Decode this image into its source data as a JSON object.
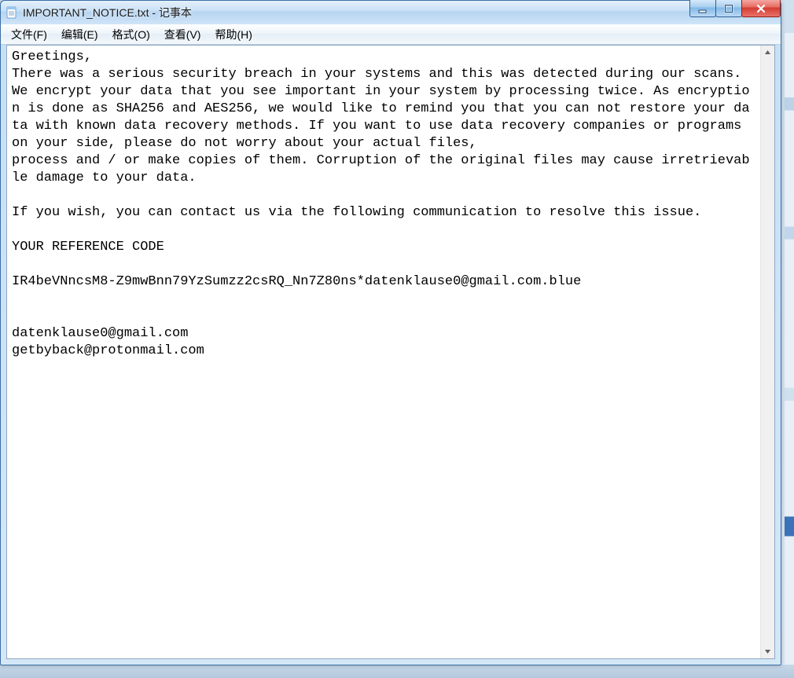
{
  "window": {
    "title": "IMPORTANT_NOTICE.txt - 记事本"
  },
  "menu": {
    "file": "文件(F)",
    "edit": "编辑(E)",
    "format": "格式(O)",
    "view": "查看(V)",
    "help": "帮助(H)"
  },
  "content": "Greetings,\nThere was a serious security breach in your systems and this was detected during our scans.\nWe encrypt your data that you see important in your system by processing twice. As encryption is done as SHA256 and AES256, we would like to remind you that you can not restore your data with known data recovery methods. If you want to use data recovery companies or programs on your side, please do not worry about your actual files,\nprocess and / or make copies of them. Corruption of the original files may cause irretrievable damage to your data.\n\nIf you wish, you can contact us via the following communication to resolve this issue.\n\nYOUR REFERENCE CODE\n\nIR4beVNncsM8-Z9mwBnn79YzSumzz2csRQ_Nn7Z80ns*datenklause0@gmail.com.blue\n\n\ndatenklause0@gmail.com\ngetbyback@protonmail.com"
}
